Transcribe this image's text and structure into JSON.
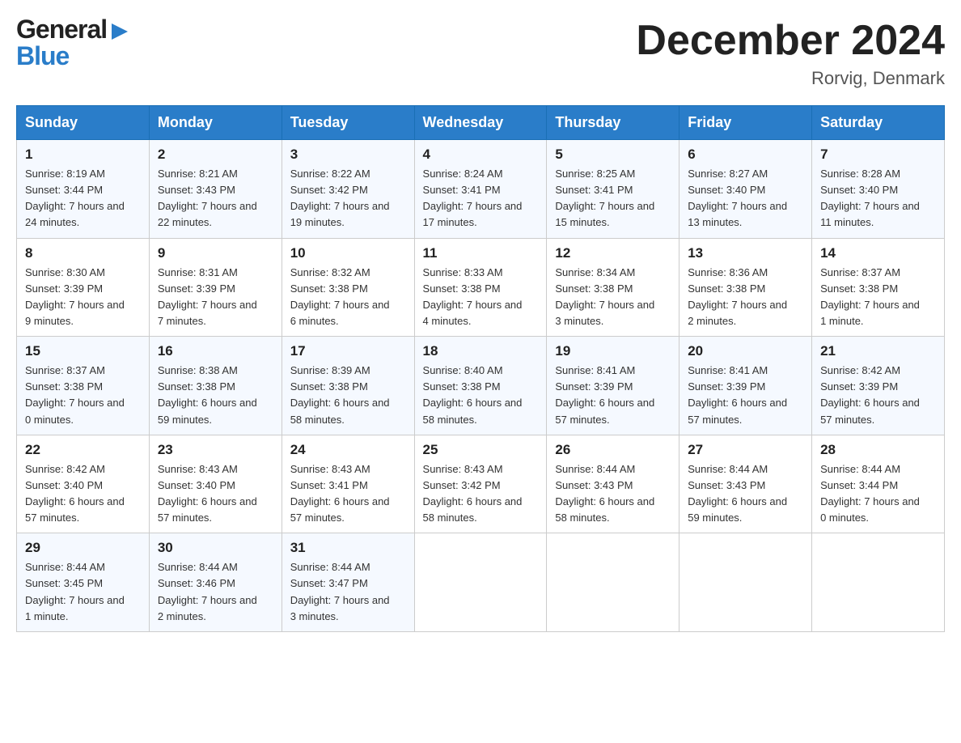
{
  "header": {
    "month_title": "December 2024",
    "location": "Rorvig, Denmark",
    "logo_top": "General",
    "logo_bottom": "Blue"
  },
  "days_of_week": [
    "Sunday",
    "Monday",
    "Tuesday",
    "Wednesday",
    "Thursday",
    "Friday",
    "Saturday"
  ],
  "weeks": [
    [
      {
        "day": "1",
        "sunrise": "8:19 AM",
        "sunset": "3:44 PM",
        "daylight": "7 hours and 24 minutes."
      },
      {
        "day": "2",
        "sunrise": "8:21 AM",
        "sunset": "3:43 PM",
        "daylight": "7 hours and 22 minutes."
      },
      {
        "day": "3",
        "sunrise": "8:22 AM",
        "sunset": "3:42 PM",
        "daylight": "7 hours and 19 minutes."
      },
      {
        "day": "4",
        "sunrise": "8:24 AM",
        "sunset": "3:41 PM",
        "daylight": "7 hours and 17 minutes."
      },
      {
        "day": "5",
        "sunrise": "8:25 AM",
        "sunset": "3:41 PM",
        "daylight": "7 hours and 15 minutes."
      },
      {
        "day": "6",
        "sunrise": "8:27 AM",
        "sunset": "3:40 PM",
        "daylight": "7 hours and 13 minutes."
      },
      {
        "day": "7",
        "sunrise": "8:28 AM",
        "sunset": "3:40 PM",
        "daylight": "7 hours and 11 minutes."
      }
    ],
    [
      {
        "day": "8",
        "sunrise": "8:30 AM",
        "sunset": "3:39 PM",
        "daylight": "7 hours and 9 minutes."
      },
      {
        "day": "9",
        "sunrise": "8:31 AM",
        "sunset": "3:39 PM",
        "daylight": "7 hours and 7 minutes."
      },
      {
        "day": "10",
        "sunrise": "8:32 AM",
        "sunset": "3:38 PM",
        "daylight": "7 hours and 6 minutes."
      },
      {
        "day": "11",
        "sunrise": "8:33 AM",
        "sunset": "3:38 PM",
        "daylight": "7 hours and 4 minutes."
      },
      {
        "day": "12",
        "sunrise": "8:34 AM",
        "sunset": "3:38 PM",
        "daylight": "7 hours and 3 minutes."
      },
      {
        "day": "13",
        "sunrise": "8:36 AM",
        "sunset": "3:38 PM",
        "daylight": "7 hours and 2 minutes."
      },
      {
        "day": "14",
        "sunrise": "8:37 AM",
        "sunset": "3:38 PM",
        "daylight": "7 hours and 1 minute."
      }
    ],
    [
      {
        "day": "15",
        "sunrise": "8:37 AM",
        "sunset": "3:38 PM",
        "daylight": "7 hours and 0 minutes."
      },
      {
        "day": "16",
        "sunrise": "8:38 AM",
        "sunset": "3:38 PM",
        "daylight": "6 hours and 59 minutes."
      },
      {
        "day": "17",
        "sunrise": "8:39 AM",
        "sunset": "3:38 PM",
        "daylight": "6 hours and 58 minutes."
      },
      {
        "day": "18",
        "sunrise": "8:40 AM",
        "sunset": "3:38 PM",
        "daylight": "6 hours and 58 minutes."
      },
      {
        "day": "19",
        "sunrise": "8:41 AM",
        "sunset": "3:39 PM",
        "daylight": "6 hours and 57 minutes."
      },
      {
        "day": "20",
        "sunrise": "8:41 AM",
        "sunset": "3:39 PM",
        "daylight": "6 hours and 57 minutes."
      },
      {
        "day": "21",
        "sunrise": "8:42 AM",
        "sunset": "3:39 PM",
        "daylight": "6 hours and 57 minutes."
      }
    ],
    [
      {
        "day": "22",
        "sunrise": "8:42 AM",
        "sunset": "3:40 PM",
        "daylight": "6 hours and 57 minutes."
      },
      {
        "day": "23",
        "sunrise": "8:43 AM",
        "sunset": "3:40 PM",
        "daylight": "6 hours and 57 minutes."
      },
      {
        "day": "24",
        "sunrise": "8:43 AM",
        "sunset": "3:41 PM",
        "daylight": "6 hours and 57 minutes."
      },
      {
        "day": "25",
        "sunrise": "8:43 AM",
        "sunset": "3:42 PM",
        "daylight": "6 hours and 58 minutes."
      },
      {
        "day": "26",
        "sunrise": "8:44 AM",
        "sunset": "3:43 PM",
        "daylight": "6 hours and 58 minutes."
      },
      {
        "day": "27",
        "sunrise": "8:44 AM",
        "sunset": "3:43 PM",
        "daylight": "6 hours and 59 minutes."
      },
      {
        "day": "28",
        "sunrise": "8:44 AM",
        "sunset": "3:44 PM",
        "daylight": "7 hours and 0 minutes."
      }
    ],
    [
      {
        "day": "29",
        "sunrise": "8:44 AM",
        "sunset": "3:45 PM",
        "daylight": "7 hours and 1 minute."
      },
      {
        "day": "30",
        "sunrise": "8:44 AM",
        "sunset": "3:46 PM",
        "daylight": "7 hours and 2 minutes."
      },
      {
        "day": "31",
        "sunrise": "8:44 AM",
        "sunset": "3:47 PM",
        "daylight": "7 hours and 3 minutes."
      },
      null,
      null,
      null,
      null
    ]
  ],
  "labels": {
    "sunrise": "Sunrise:",
    "sunset": "Sunset:",
    "daylight": "Daylight:"
  }
}
